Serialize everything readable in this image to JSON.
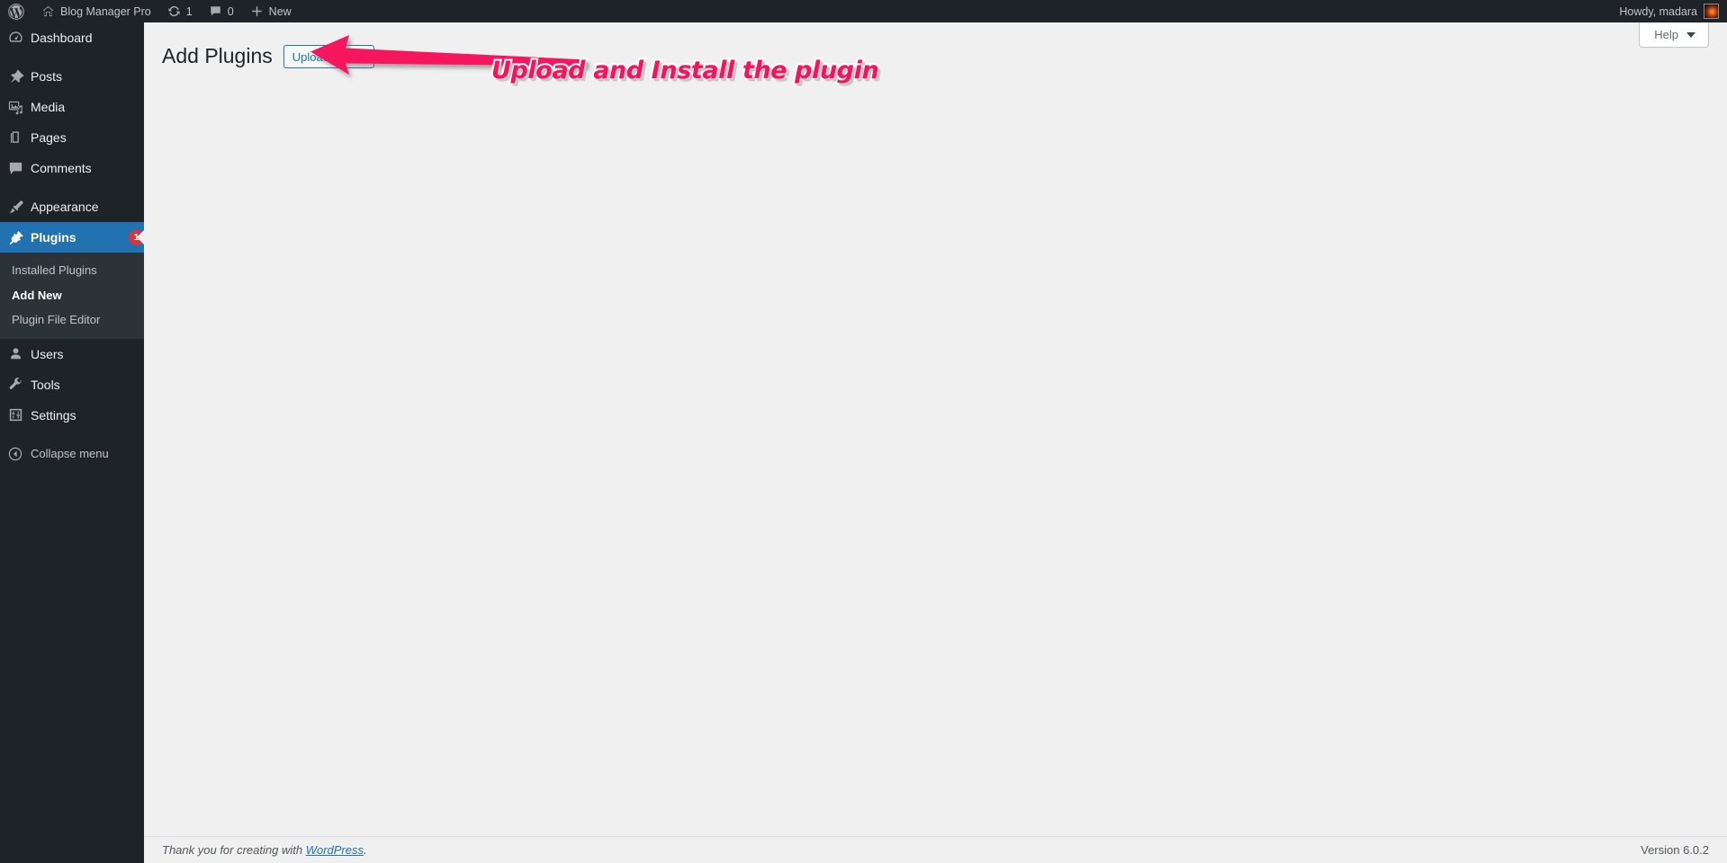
{
  "adminbar": {
    "wp_logo": "wordpress-logo-icon",
    "site_name": "Blog Manager Pro",
    "site_icon": "home-icon",
    "updates_icon": "updates-icon",
    "updates_count": "1",
    "comments_icon": "comment-bubble-icon",
    "comments_count": "0",
    "new_icon": "plus-icon",
    "new_label": "New",
    "howdy": "Howdy, madara",
    "avatar": "user-avatar-image"
  },
  "sidebar": {
    "items": [
      {
        "label": "Dashboard",
        "icon": "dashboard-icon",
        "current": false,
        "badge": ""
      },
      {
        "label": "Posts",
        "icon": "pin-icon",
        "current": false,
        "badge": ""
      },
      {
        "label": "Media",
        "icon": "media-icon",
        "current": false,
        "badge": ""
      },
      {
        "label": "Pages",
        "icon": "pages-icon",
        "current": false,
        "badge": ""
      },
      {
        "label": "Comments",
        "icon": "comment-bubble-icon",
        "current": false,
        "badge": ""
      },
      {
        "label": "Appearance",
        "icon": "paintbrush-icon",
        "current": false,
        "badge": ""
      },
      {
        "label": "Plugins",
        "icon": "plugin-icon",
        "current": true,
        "badge": "1"
      },
      {
        "label": "Users",
        "icon": "user-icon",
        "current": false,
        "badge": ""
      },
      {
        "label": "Tools",
        "icon": "wrench-icon",
        "current": false,
        "badge": ""
      },
      {
        "label": "Settings",
        "icon": "settings-sliders-icon",
        "current": false,
        "badge": ""
      }
    ],
    "plugins_submenu": [
      {
        "label": "Installed Plugins",
        "current": false
      },
      {
        "label": "Add New",
        "current": true
      },
      {
        "label": "Plugin File Editor",
        "current": false
      }
    ],
    "collapse": {
      "label": "Collapse menu",
      "icon": "collapse-arrow-icon"
    }
  },
  "screen_meta": {
    "help_label": "Help",
    "help_caret": "chevron-down-icon"
  },
  "page": {
    "title": "Add Plugins",
    "upload_button": "Upload Plugin"
  },
  "annotation": {
    "text": "Upload and Install the plugin",
    "arrow": "left-pointing-arrow",
    "color": "#f5125f",
    "outline_color": "#ffffff"
  },
  "footer": {
    "thanks_prefix": "Thank you for creating with ",
    "wordpress_link": "WordPress",
    "thanks_suffix": ".",
    "version": "Version 6.0.2"
  },
  "theme": {
    "adminbar_bg": "#1d2327",
    "sidebar_bg": "#1d2327",
    "submenu_bg": "#2c3338",
    "accent_blue": "#2271b1",
    "badge_red": "#d63638",
    "content_bg": "#f0f0f1"
  }
}
